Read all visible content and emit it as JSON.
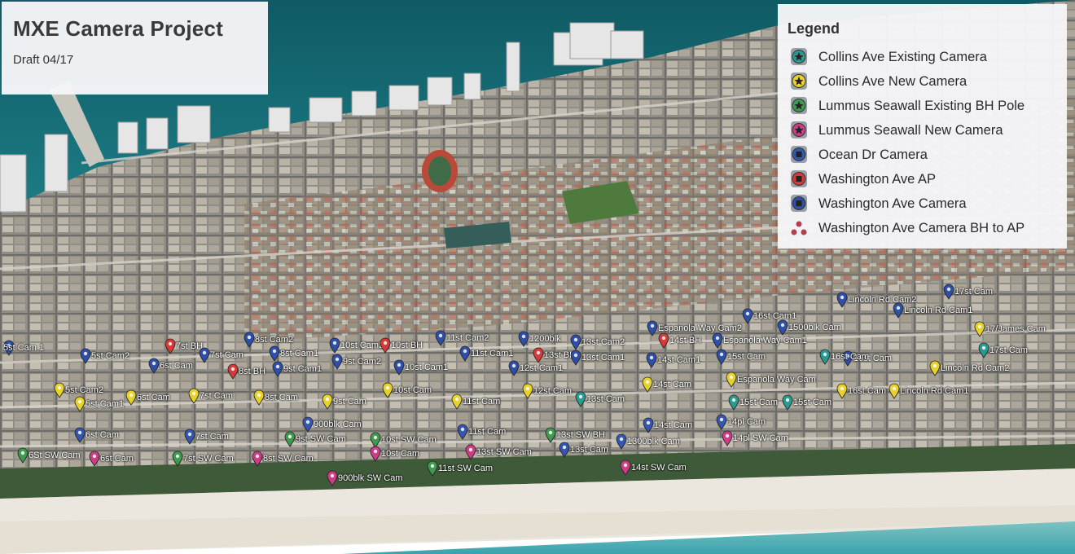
{
  "title": "MXE Camera Project",
  "subtitle": "Draft 04/17",
  "legend": {
    "heading": "Legend",
    "items": [
      {
        "label": "Collins Ave Existing Camera",
        "color": "#2a9a90",
        "icon": "star-pin-icon"
      },
      {
        "label": "Collins Ave New Camera",
        "color": "#e8d22a",
        "icon": "star-pin-icon"
      },
      {
        "label": "Lummus Seawall Existing BH Pole",
        "color": "#3d9a4f",
        "icon": "star-pin-icon"
      },
      {
        "label": "Lummus Seawall New Camera",
        "color": "#cc3d86",
        "icon": "star-pin-icon"
      },
      {
        "label": "Ocean Dr Camera",
        "color": "#3456b0",
        "icon": "square-pin-icon"
      },
      {
        "label": "Washington Ave AP",
        "color": "#d93838",
        "icon": "square-pin-icon"
      },
      {
        "label": "Washington Ave Camera",
        "color": "#2e4ea8",
        "icon": "square-pin-icon"
      },
      {
        "label": "Washington Ave Camera BH to AP",
        "color": "#b04050",
        "icon": "triangle-dots-icon"
      }
    ]
  },
  "markers": [
    {
      "text": "5st Cam 1",
      "c": "#2e4ea8"
    },
    {
      "text": "5st Cam2",
      "c": "#2e4ea8"
    },
    {
      "text": "6st Cam",
      "c": "#2e4ea8"
    },
    {
      "text": "7st BH",
      "c": "#d93838"
    },
    {
      "text": "7st Cam",
      "c": "#2e4ea8"
    },
    {
      "text": "8st BH",
      "c": "#d93838"
    },
    {
      "text": "8st Cam2",
      "c": "#2e4ea8"
    },
    {
      "text": "8st Cam1",
      "c": "#2e4ea8"
    },
    {
      "text": "9st Cam1",
      "c": "#2e4ea8"
    },
    {
      "text": "10st Cam2",
      "c": "#2e4ea8"
    },
    {
      "text": "9st Cam2",
      "c": "#2e4ea8"
    },
    {
      "text": "10st BH",
      "c": "#d93838"
    },
    {
      "text": "10st Cam1",
      "c": "#2e4ea8"
    },
    {
      "text": "11st Cam2",
      "c": "#2e4ea8"
    },
    {
      "text": "11st Cam1",
      "c": "#2e4ea8"
    },
    {
      "text": "1200blk",
      "c": "#2e4ea8"
    },
    {
      "text": "13st BH",
      "c": "#d93838"
    },
    {
      "text": "12st Cam1",
      "c": "#2e4ea8"
    },
    {
      "text": "13st Cam2",
      "c": "#2e4ea8"
    },
    {
      "text": "13st Cam1",
      "c": "#2e4ea8"
    },
    {
      "text": "Espanola Way Cam2",
      "c": "#2e4ea8"
    },
    {
      "text": "14st BH",
      "c": "#d93838"
    },
    {
      "text": "14st Cam1",
      "c": "#2e4ea8"
    },
    {
      "text": "Espanola Way Cam1",
      "c": "#2e4ea8"
    },
    {
      "text": "15st Cam",
      "c": "#2e4ea8"
    },
    {
      "text": "16st Cam",
      "c": "#2e4ea8"
    },
    {
      "text": "16st Cam1",
      "c": "#2e4ea8"
    },
    {
      "text": "1500blk Cam",
      "c": "#2e4ea8"
    },
    {
      "text": "Lincoln Rd Cam2",
      "c": "#2e4ea8"
    },
    {
      "text": "Lincoln Rd Cam1",
      "c": "#2e4ea8"
    },
    {
      "text": "17st Cam",
      "c": "#2e4ea8"
    },
    {
      "text": "17/James Cam",
      "c": "#e8d22a"
    },
    {
      "text": "17st Cam",
      "c": "#2a9a90"
    },
    {
      "text": "16st Cam",
      "c": "#2a9a90"
    },
    {
      "text": "Lincoln Rd Cam2",
      "c": "#e8d22a"
    },
    {
      "text": "Lincoln Rd Cam1",
      "c": "#e8d22a"
    },
    {
      "text": "Espanola Way Cam",
      "c": "#e8d22a"
    },
    {
      "text": "14st Cam",
      "c": "#e8d22a"
    },
    {
      "text": "15st Cam",
      "c": "#2a9a90"
    },
    {
      "text": "15st Cam",
      "c": "#2a9a90"
    },
    {
      "text": "16st Cam",
      "c": "#e8d22a"
    },
    {
      "text": "13st Cam",
      "c": "#2a9a90"
    },
    {
      "text": "12st Cam",
      "c": "#e8d22a"
    },
    {
      "text": "11st Cam",
      "c": "#e8d22a"
    },
    {
      "text": "10st Cam",
      "c": "#e8d22a"
    },
    {
      "text": "9st Cam",
      "c": "#e8d22a"
    },
    {
      "text": "8st Cam",
      "c": "#e8d22a"
    },
    {
      "text": "7st Cam",
      "c": "#e8d22a"
    },
    {
      "text": "6st Cam",
      "c": "#e8d22a"
    },
    {
      "text": "5st Cam2",
      "c": "#e8d22a"
    },
    {
      "text": "5st Cam1",
      "c": "#e8d22a"
    },
    {
      "text": "6st Cam",
      "c": "#3456b0"
    },
    {
      "text": "7st Cam",
      "c": "#3456b0"
    },
    {
      "text": "900blk Cam",
      "c": "#3456b0"
    },
    {
      "text": "9st SW Cam",
      "c": "#3d9a4f"
    },
    {
      "text": "10st SW Cam",
      "c": "#3d9a4f"
    },
    {
      "text": "11st Cam",
      "c": "#3456b0"
    },
    {
      "text": "13st SW Cam",
      "c": "#cc3d86"
    },
    {
      "text": "13st SW BH",
      "c": "#3d9a4f"
    },
    {
      "text": "13st Cam",
      "c": "#3456b0"
    },
    {
      "text": "1300blk Cam",
      "c": "#3456b0"
    },
    {
      "text": "14st Cam",
      "c": "#3456b0"
    },
    {
      "text": "14pl Cam",
      "c": "#3456b0"
    },
    {
      "text": "14pl SW Cam",
      "c": "#cc3d86"
    },
    {
      "text": "14st SW Cam",
      "c": "#cc3d86"
    },
    {
      "text": "11st SW Cam",
      "c": "#3d9a4f"
    },
    {
      "text": "10st Cam",
      "c": "#cc3d86"
    },
    {
      "text": "900blk SW Cam",
      "c": "#cc3d86"
    },
    {
      "text": "8st SW Cam",
      "c": "#cc3d86"
    },
    {
      "text": "7st SW Cam",
      "c": "#3d9a4f"
    },
    {
      "text": "6st Cam",
      "c": "#cc3d86"
    },
    {
      "text": "6St SW Cam",
      "c": "#3d9a4f"
    }
  ]
}
